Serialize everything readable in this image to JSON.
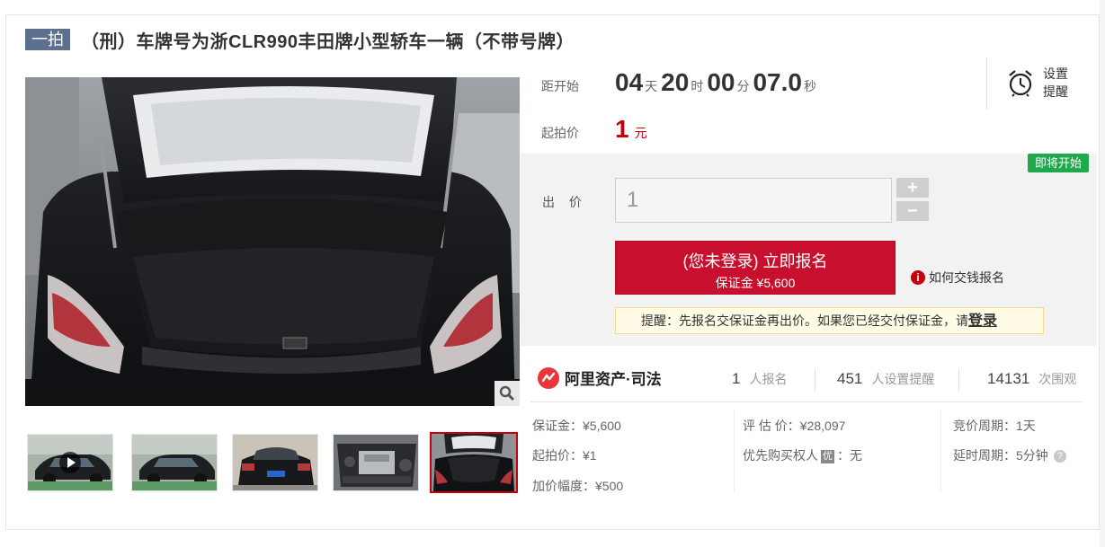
{
  "listing": {
    "tag": "一拍",
    "title": "（刑）车牌号为浙CLR990丰田牌小型轿车一辆（不带号牌）"
  },
  "countdown": {
    "label": "距开始",
    "days": "04",
    "days_unit": "天",
    "hours": "20",
    "hours_unit": "时",
    "minutes": "00",
    "minutes_unit": "分",
    "seconds": "07.0",
    "seconds_unit": "秒"
  },
  "start_price": {
    "label": "起拍价",
    "value": "1",
    "unit": "元"
  },
  "reminder": {
    "label_line1": "设置",
    "label_line2": "提醒",
    "icon": "alarm-clock-icon"
  },
  "bid": {
    "badge": "即将开始",
    "label": "出 价",
    "value": "1",
    "plus": "+",
    "minus": "−"
  },
  "apply_button": {
    "main": "(您未登录) 立即报名",
    "sub": "保证金 ¥5,600"
  },
  "howto": {
    "icon_text": "i",
    "label": "如何交钱报名"
  },
  "tip": {
    "text": "提醒：先报名交保证金再出价。如果您已经交付保证金，请",
    "link": "登录"
  },
  "brand": {
    "name": "阿里资产·司法"
  },
  "stats": [
    {
      "num": "1",
      "unit": "人报名"
    },
    {
      "num": "451",
      "unit": "人设置提醒"
    },
    {
      "num": "14131",
      "unit": "次围观"
    }
  ],
  "details": {
    "deposit": "保证金：¥5,600",
    "start_price": "起拍价：¥1",
    "increment": "加价幅度：¥500",
    "appraisal": "评 估 价：¥28,097",
    "priority_label": "优先购买权人",
    "priority_badge": "优",
    "priority_value": "：无",
    "cycle": "竞价周期：1天",
    "delay": "延时周期：5分钟",
    "help": "?"
  },
  "colors": {
    "accent": "#c8102e",
    "tag_bg": "#5b6f8e",
    "badge_green": "#20a84c"
  },
  "thumbnails": [
    "video-car-side",
    "car-side",
    "car-rear-plate",
    "engine-bay",
    "open-trunk"
  ]
}
